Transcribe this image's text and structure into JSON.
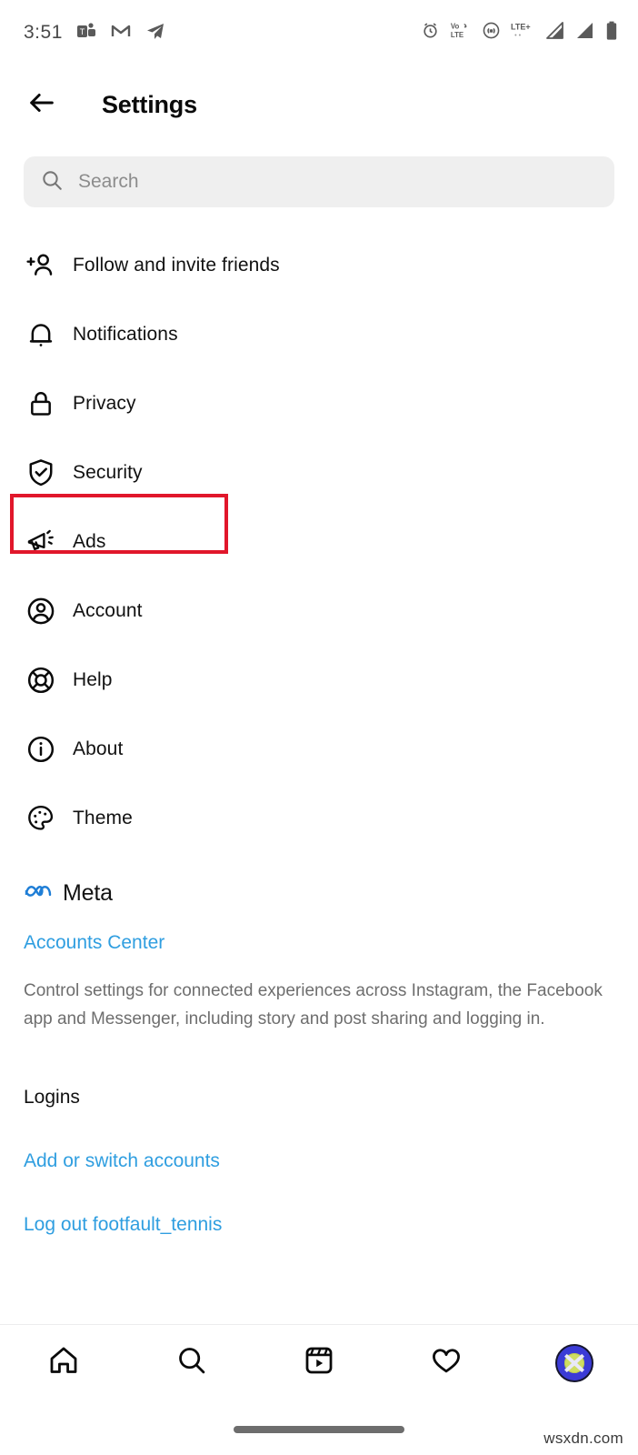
{
  "status_bar": {
    "time": "3:51",
    "left_icons": [
      {
        "name": "teams-icon"
      },
      {
        "name": "gmail-icon"
      },
      {
        "name": "telegram-icon"
      }
    ],
    "right_icons": [
      {
        "name": "alarm-clock-icon"
      },
      {
        "name": "volte-icon",
        "label_top": "Vo",
        "label_bottom": "LTE"
      },
      {
        "name": "hotspot-icon"
      },
      {
        "name": "lte-plus-icon",
        "label": "LTE+"
      },
      {
        "name": "signal-bars-1-icon"
      },
      {
        "name": "signal-bars-2-icon"
      },
      {
        "name": "battery-icon"
      }
    ]
  },
  "header": {
    "back_icon": "arrow-left-icon",
    "title": "Settings"
  },
  "search": {
    "icon": "search-icon",
    "placeholder": "Search",
    "value": ""
  },
  "menu": {
    "items": [
      {
        "icon": "person-add-icon",
        "label": "Follow and invite friends"
      },
      {
        "icon": "bell-icon",
        "label": "Notifications"
      },
      {
        "icon": "lock-icon",
        "label": "Privacy"
      },
      {
        "icon": "shield-check-icon",
        "label": "Security"
      },
      {
        "icon": "megaphone-icon",
        "label": "Ads"
      },
      {
        "icon": "account-circle-icon",
        "label": "Account"
      },
      {
        "icon": "life-ring-icon",
        "label": "Help"
      },
      {
        "icon": "info-circle-icon",
        "label": "About"
      },
      {
        "icon": "palette-icon",
        "label": "Theme"
      }
    ],
    "highlighted_item": "Account",
    "highlight_color": "#e1172b"
  },
  "meta_section": {
    "logo_icon": "meta-infinity-icon",
    "logo_text": "Meta",
    "accounts_center_link": "Accounts Center",
    "description": "Control settings for connected experiences across Instagram, the Facebook app and Messenger, including story and post sharing and logging in."
  },
  "logins": {
    "heading": "Logins",
    "add_or_switch_link": "Add or switch accounts",
    "log_out_link": "Log out footfault_tennis"
  },
  "bottom_nav": {
    "items": [
      {
        "icon": "home-icon",
        "name": "nav-home"
      },
      {
        "icon": "search-icon",
        "name": "nav-search"
      },
      {
        "icon": "reels-icon",
        "name": "nav-reels"
      },
      {
        "icon": "heart-icon",
        "name": "nav-activity"
      },
      {
        "icon": "avatar-icon",
        "name": "nav-profile"
      }
    ]
  },
  "watermark": "wsxdn.com",
  "colors": {
    "link_blue": "#2f9ee0",
    "meta_blue": "#1f7ed6",
    "highlight_red": "#e1172b",
    "search_bg": "#efefef",
    "muted_text": "#6e6e6e"
  }
}
